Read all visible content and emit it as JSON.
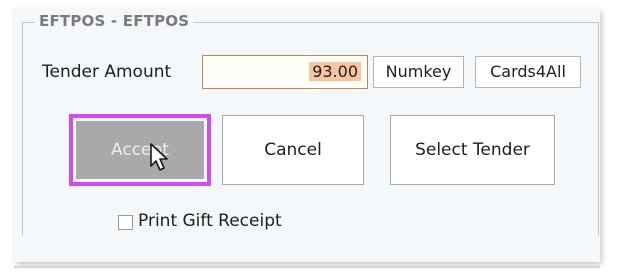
{
  "group": {
    "title": "EFTPOS - EFTPOS"
  },
  "tender": {
    "label": "Tender Amount",
    "amount_value": "93.00",
    "numkey_label": "Numkey",
    "cards_label": "Cards4All"
  },
  "actions": {
    "accept_label": "Accept",
    "cancel_label": "Cancel",
    "select_tender_label": "Select Tender"
  },
  "print_gift_receipt": {
    "label": "Print Gift Receipt",
    "checked": false
  },
  "colors": {
    "highlight_outline": "#d04ef0",
    "accept_disabled_bg": "#a9a9a9",
    "amount_selection": "#f7c59f",
    "amount_border": "#b98a4a"
  },
  "icons": {
    "cursor": "mouse-pointer-icon"
  }
}
